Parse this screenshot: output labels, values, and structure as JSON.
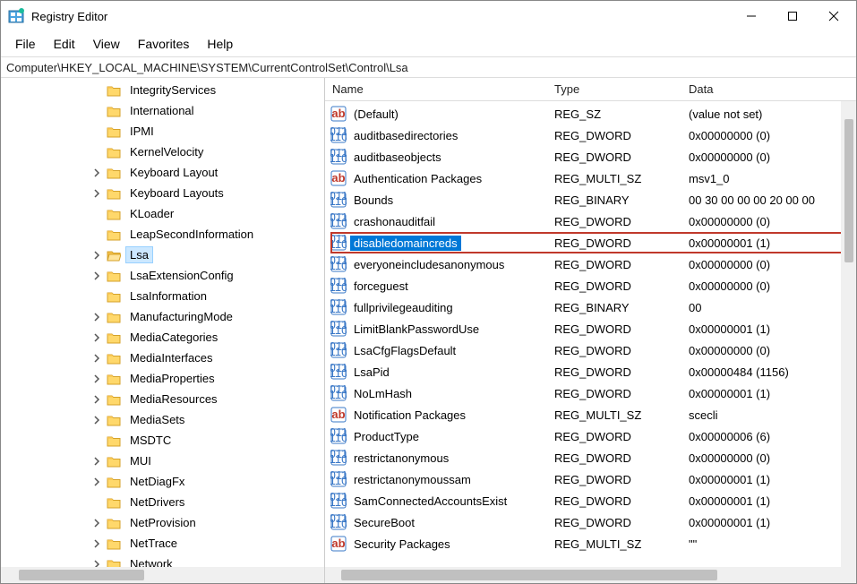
{
  "title": "Registry Editor",
  "menus": {
    "file": "File",
    "edit": "Edit",
    "view": "View",
    "favorites": "Favorites",
    "help": "Help"
  },
  "address": "Computer\\HKEY_LOCAL_MACHINE\\SYSTEM\\CurrentControlSet\\Control\\Lsa",
  "columns": {
    "name": "Name",
    "type": "Type",
    "data": "Data"
  },
  "tree": {
    "indent_base": 94,
    "items": [
      {
        "label": "IntegrityServices",
        "exp": "none"
      },
      {
        "label": "International",
        "exp": "none"
      },
      {
        "label": "IPMI",
        "exp": "none"
      },
      {
        "label": "KernelVelocity",
        "exp": "none"
      },
      {
        "label": "Keyboard Layout",
        "exp": "closed"
      },
      {
        "label": "Keyboard Layouts",
        "exp": "closed"
      },
      {
        "label": "KLoader",
        "exp": "none"
      },
      {
        "label": "LeapSecondInformation",
        "exp": "none"
      },
      {
        "label": "Lsa",
        "exp": "closed",
        "selected": true
      },
      {
        "label": "LsaExtensionConfig",
        "exp": "closed"
      },
      {
        "label": "LsaInformation",
        "exp": "none"
      },
      {
        "label": "ManufacturingMode",
        "exp": "closed"
      },
      {
        "label": "MediaCategories",
        "exp": "closed"
      },
      {
        "label": "MediaInterfaces",
        "exp": "closed"
      },
      {
        "label": "MediaProperties",
        "exp": "closed"
      },
      {
        "label": "MediaResources",
        "exp": "closed"
      },
      {
        "label": "MediaSets",
        "exp": "closed"
      },
      {
        "label": "MSDTC",
        "exp": "none"
      },
      {
        "label": "MUI",
        "exp": "closed"
      },
      {
        "label": "NetDiagFx",
        "exp": "closed"
      },
      {
        "label": "NetDrivers",
        "exp": "none"
      },
      {
        "label": "NetProvision",
        "exp": "closed"
      },
      {
        "label": "NetTrace",
        "exp": "closed"
      },
      {
        "label": "Network",
        "exp": "closed"
      }
    ]
  },
  "values": [
    {
      "icon": "sz",
      "name": "(Default)",
      "type": "REG_SZ",
      "data": "(value not set)"
    },
    {
      "icon": "bin",
      "name": "auditbasedirectories",
      "type": "REG_DWORD",
      "data": "0x00000000 (0)"
    },
    {
      "icon": "bin",
      "name": "auditbaseobjects",
      "type": "REG_DWORD",
      "data": "0x00000000 (0)"
    },
    {
      "icon": "sz",
      "name": "Authentication Packages",
      "type": "REG_MULTI_SZ",
      "data": "msv1_0"
    },
    {
      "icon": "bin",
      "name": "Bounds",
      "type": "REG_BINARY",
      "data": "00 30 00 00 00 20 00 00"
    },
    {
      "icon": "bin",
      "name": "crashonauditfail",
      "type": "REG_DWORD",
      "data": "0x00000000 (0)"
    },
    {
      "icon": "bin",
      "name": "disabledomaincreds",
      "type": "REG_DWORD",
      "data": "0x00000001 (1)",
      "selected": true,
      "highlighted": true
    },
    {
      "icon": "bin",
      "name": "everyoneincludesanonymous",
      "type": "REG_DWORD",
      "data": "0x00000000 (0)"
    },
    {
      "icon": "bin",
      "name": "forceguest",
      "type": "REG_DWORD",
      "data": "0x00000000 (0)"
    },
    {
      "icon": "bin",
      "name": "fullprivilegeauditing",
      "type": "REG_BINARY",
      "data": "00"
    },
    {
      "icon": "bin",
      "name": "LimitBlankPasswordUse",
      "type": "REG_DWORD",
      "data": "0x00000001 (1)"
    },
    {
      "icon": "bin",
      "name": "LsaCfgFlagsDefault",
      "type": "REG_DWORD",
      "data": "0x00000000 (0)"
    },
    {
      "icon": "bin",
      "name": "LsaPid",
      "type": "REG_DWORD",
      "data": "0x00000484 (1156)"
    },
    {
      "icon": "bin",
      "name": "NoLmHash",
      "type": "REG_DWORD",
      "data": "0x00000001 (1)"
    },
    {
      "icon": "sz",
      "name": "Notification Packages",
      "type": "REG_MULTI_SZ",
      "data": "scecli"
    },
    {
      "icon": "bin",
      "name": "ProductType",
      "type": "REG_DWORD",
      "data": "0x00000006 (6)"
    },
    {
      "icon": "bin",
      "name": "restrictanonymous",
      "type": "REG_DWORD",
      "data": "0x00000000 (0)"
    },
    {
      "icon": "bin",
      "name": "restrictanonymoussam",
      "type": "REG_DWORD",
      "data": "0x00000001 (1)"
    },
    {
      "icon": "bin",
      "name": "SamConnectedAccountsExist",
      "type": "REG_DWORD",
      "data": "0x00000001 (1)"
    },
    {
      "icon": "bin",
      "name": "SecureBoot",
      "type": "REG_DWORD",
      "data": "0x00000001 (1)"
    },
    {
      "icon": "sz",
      "name": "Security Packages",
      "type": "REG_MULTI_SZ",
      "data": "\"\""
    }
  ]
}
